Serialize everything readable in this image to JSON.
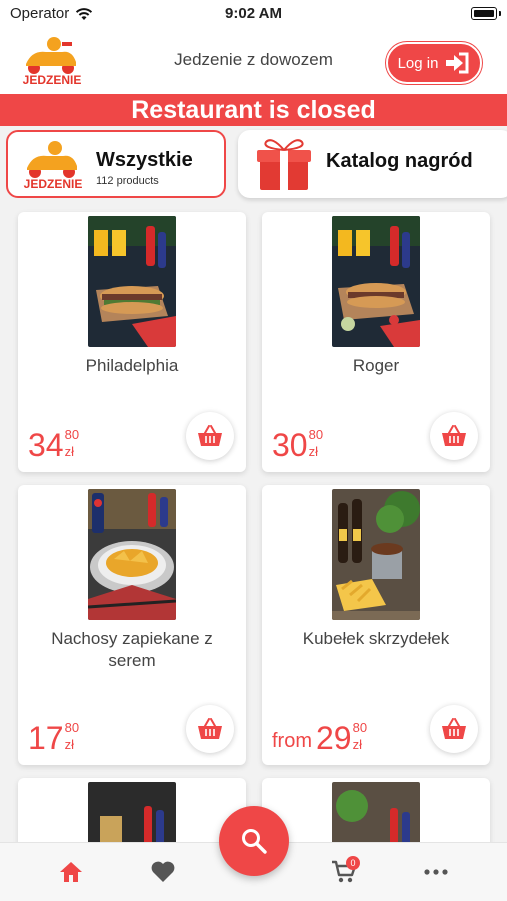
{
  "status_bar": {
    "carrier": "Operator",
    "time": "9:02 AM"
  },
  "header": {
    "title": "Jedzenie z dowozem",
    "login_label": "Log in",
    "logo_text": "JEDZENIE"
  },
  "banner": {
    "text": "Restaurant is closed"
  },
  "categories": [
    {
      "title": "Wszystkie",
      "subtitle": "112 products",
      "selected": true
    },
    {
      "title": "Katalog nagród",
      "selected": false
    }
  ],
  "products": [
    {
      "name": "Philadelphia",
      "prefix": "",
      "price_int": "34",
      "price_dec": "80",
      "currency": "zł"
    },
    {
      "name": "Roger",
      "prefix": "",
      "price_int": "30",
      "price_dec": "80",
      "currency": "zł"
    },
    {
      "name": "Nachosy zapiekane z serem",
      "prefix": "",
      "price_int": "17",
      "price_dec": "80",
      "currency": "zł"
    },
    {
      "name": "Kubełek skrzydełek",
      "prefix": "from",
      "price_int": "29",
      "price_dec": "80",
      "currency": "zł"
    }
  ],
  "bottom_nav": {
    "items": [
      "home-icon",
      "heart-icon",
      "cart-icon",
      "more-icon"
    ],
    "cart_count": "0",
    "active": "home-icon"
  },
  "colors": {
    "accent": "#ef4747",
    "background": "#f2f2f2"
  }
}
